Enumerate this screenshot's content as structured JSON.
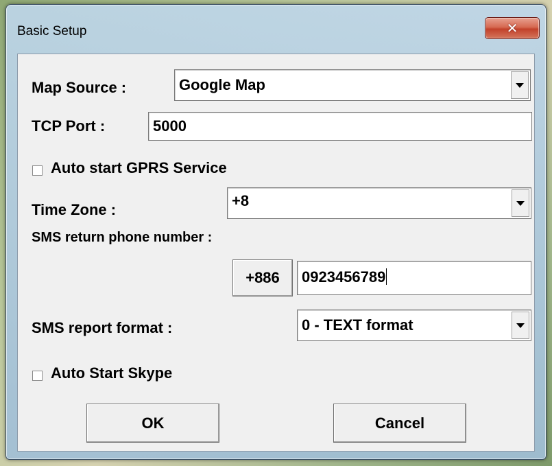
{
  "window": {
    "title": "Basic Setup",
    "close_glyph": "✕"
  },
  "map_source": {
    "label": "Map Source :",
    "value": "Google Map"
  },
  "tcp_port": {
    "label": "TCP Port :",
    "value": "5000"
  },
  "auto_gprs": {
    "label": "Auto start GPRS Service",
    "checked": false
  },
  "time_zone": {
    "label": "Time Zone :",
    "value": "+8"
  },
  "sms_phone": {
    "label": "SMS return phone number :",
    "prefix": "+886",
    "value": "0923456789"
  },
  "sms_format": {
    "label": "SMS report format :",
    "value": "0 - TEXT format"
  },
  "auto_skype": {
    "label": "Auto Start Skype",
    "checked": false
  },
  "buttons": {
    "ok": "OK",
    "cancel": "Cancel"
  }
}
